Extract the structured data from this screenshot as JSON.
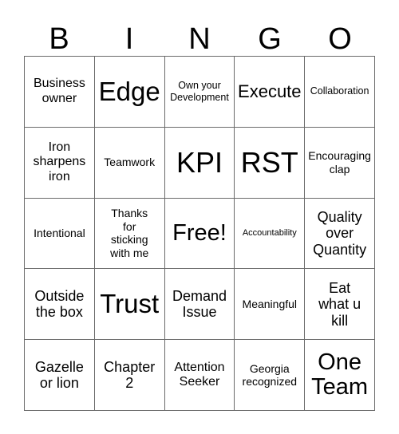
{
  "card": {
    "headers": [
      "B",
      "I",
      "N",
      "G",
      "O"
    ],
    "rows": [
      [
        {
          "text": "Business\nowner",
          "size": "sz-ml"
        },
        {
          "text": "Edge",
          "size": "sz-h1"
        },
        {
          "text": "Own your\nDevelopment",
          "size": "sz-s"
        },
        {
          "text": "Execute",
          "size": "sz-xl"
        },
        {
          "text": "Collaboration",
          "size": "sz-s"
        }
      ],
      [
        {
          "text": "Iron\nsharpens\niron",
          "size": "sz-ml"
        },
        {
          "text": "Teamwork",
          "size": "sz-m"
        },
        {
          "text": "KPI",
          "size": "sz-h2"
        },
        {
          "text": "RST",
          "size": "sz-h2"
        },
        {
          "text": "Encouraging\nclap",
          "size": "sz-m"
        }
      ],
      [
        {
          "text": "Intentional",
          "size": "sz-m"
        },
        {
          "text": "Thanks\nfor\nsticking\nwith me",
          "size": "sz-m"
        },
        {
          "text": "Free!",
          "size": "sz-xxl"
        },
        {
          "text": "Accountability",
          "size": "sz-xs"
        },
        {
          "text": "Quality\nover\nQuantity",
          "size": "sz-l"
        }
      ],
      [
        {
          "text": "Outside\nthe box",
          "size": "sz-l"
        },
        {
          "text": "Trust",
          "size": "sz-h1"
        },
        {
          "text": "Demand\nIssue",
          "size": "sz-l"
        },
        {
          "text": "Meaningful",
          "size": "sz-m"
        },
        {
          "text": "Eat\nwhat u\nkill",
          "size": "sz-l"
        }
      ],
      [
        {
          "text": "Gazelle\nor lion",
          "size": "sz-l"
        },
        {
          "text": "Chapter\n2",
          "size": "sz-l"
        },
        {
          "text": "Attention\nSeeker",
          "size": "sz-ml"
        },
        {
          "text": "Georgia\nrecognized",
          "size": "sz-m"
        },
        {
          "text": "One\nTeam",
          "size": "sz-xxl"
        }
      ]
    ]
  },
  "colors": {
    "grid_line": "#6b6b6b",
    "text": "#000000",
    "background": "#ffffff"
  }
}
